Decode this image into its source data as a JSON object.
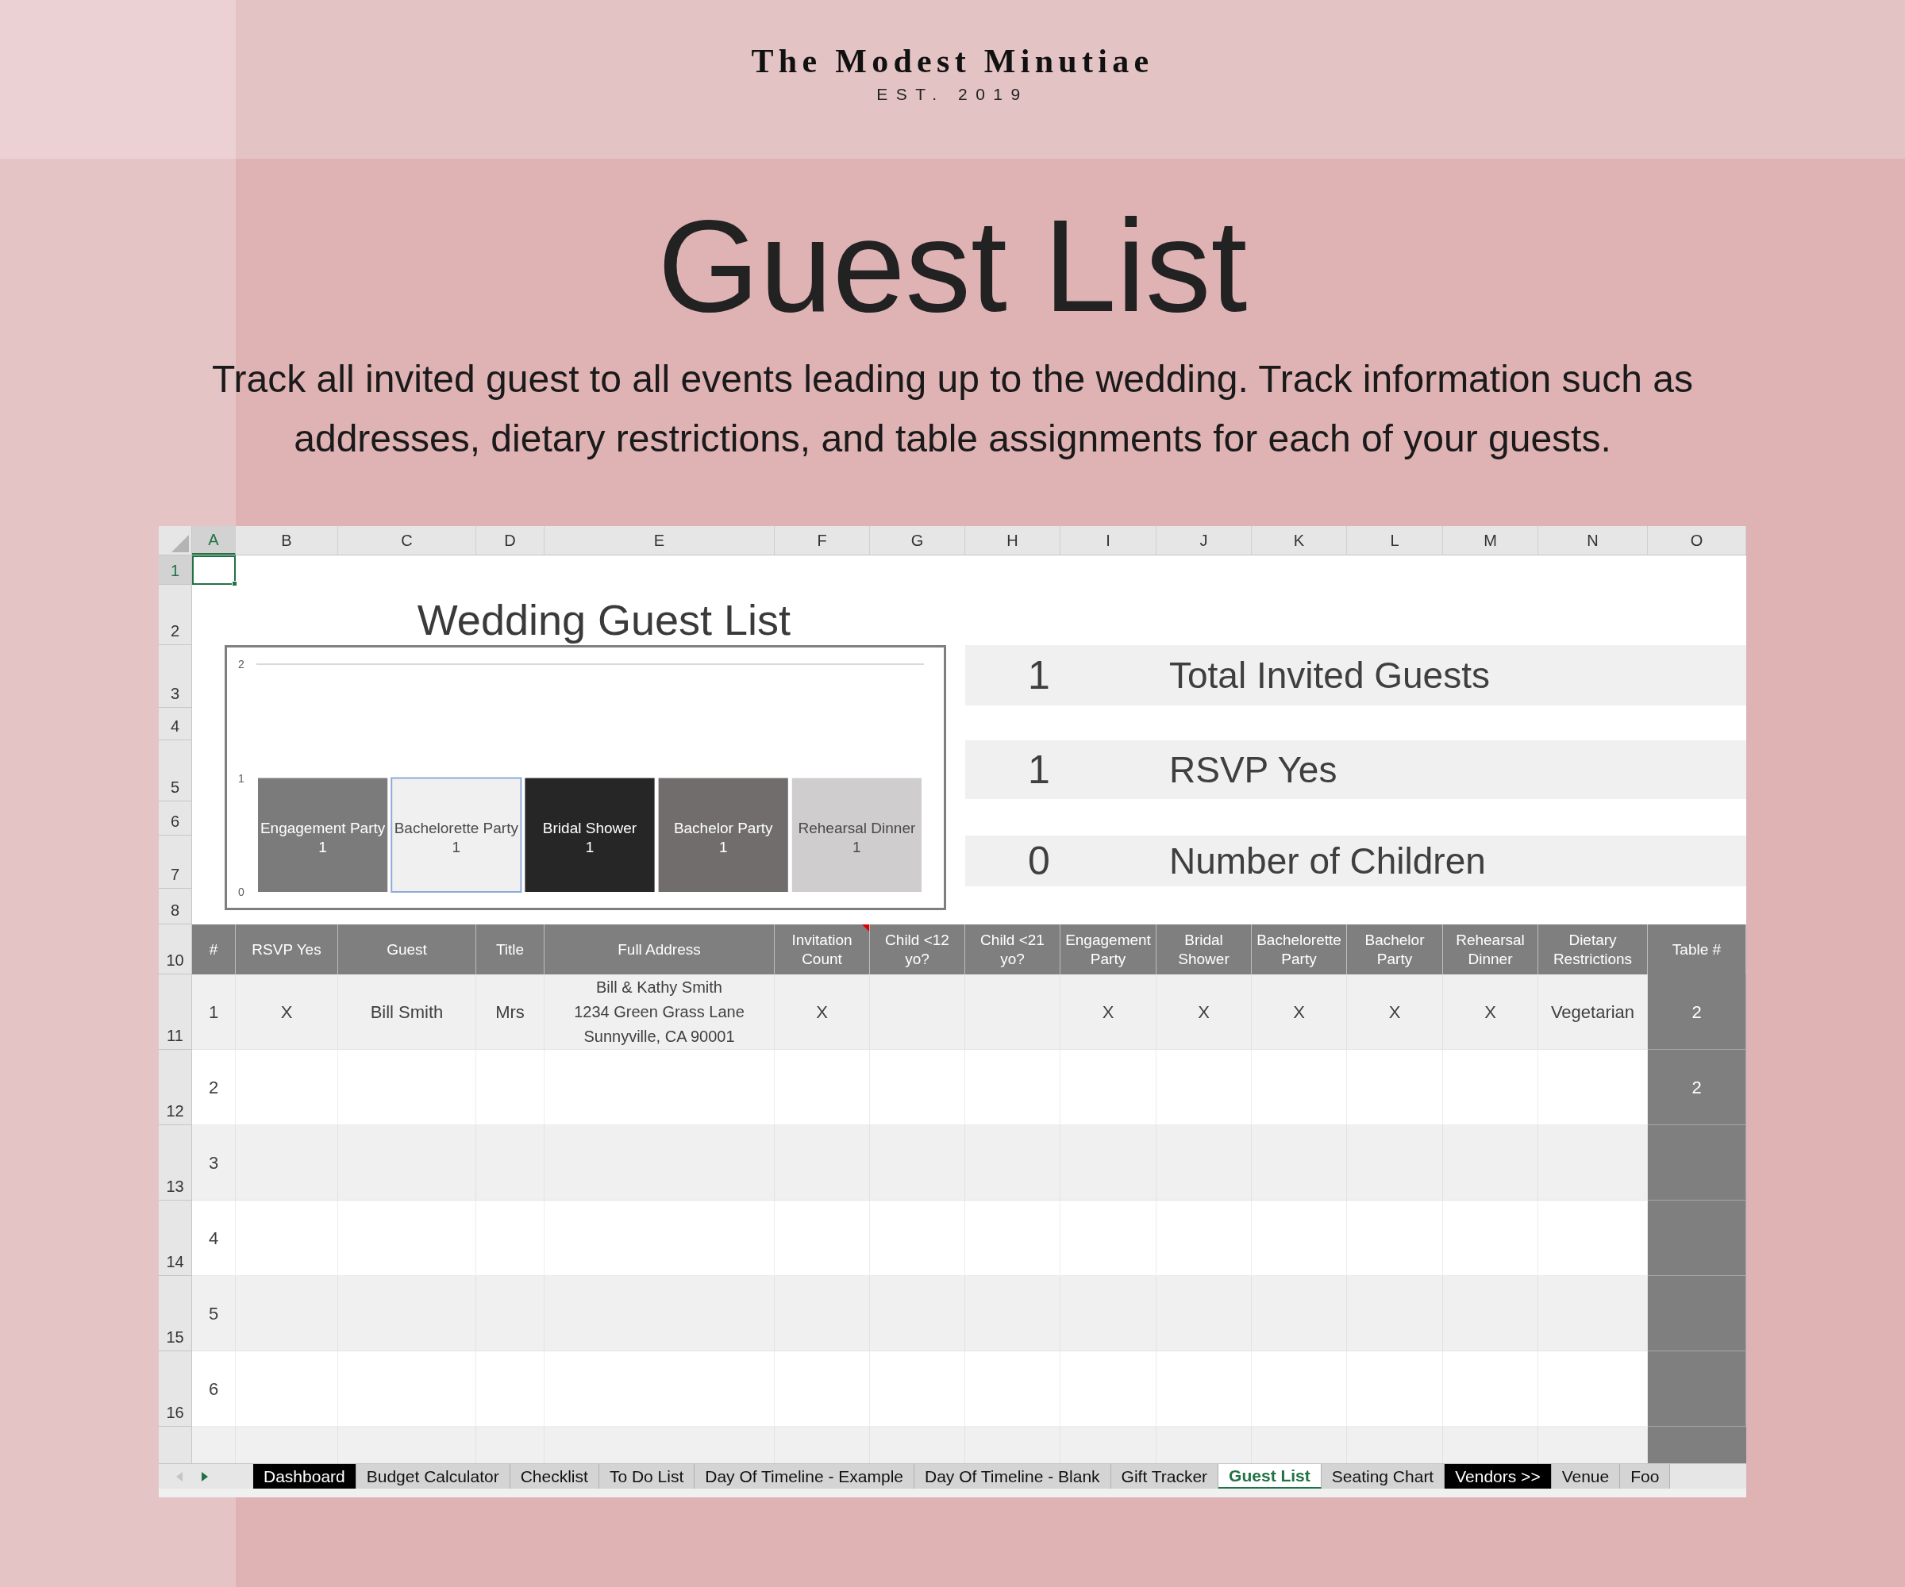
{
  "brand": {
    "name": "The Modest Minutiae",
    "established": "EST. 2019"
  },
  "heading": "Guest List",
  "description": "Track all invited guest to all events leading up to the wedding. Track information such as addresses, dietary restrictions, and table assignments for each of your guests.",
  "sheet": {
    "column_headers": [
      {
        "label": "A",
        "selected": true
      },
      {
        "label": "B",
        "selected": false
      },
      {
        "label": "C",
        "selected": false
      },
      {
        "label": "D",
        "selected": false
      },
      {
        "label": "E",
        "selected": false
      },
      {
        "label": "F",
        "selected": false
      },
      {
        "label": "G",
        "selected": false
      },
      {
        "label": "H",
        "selected": false
      },
      {
        "label": "I",
        "selected": false
      },
      {
        "label": "J",
        "selected": false
      },
      {
        "label": "K",
        "selected": false
      },
      {
        "label": "L",
        "selected": false
      },
      {
        "label": "M",
        "selected": false
      },
      {
        "label": "N",
        "selected": false
      },
      {
        "label": "O",
        "selected": false
      }
    ],
    "top_row_headers": [
      {
        "label": "1",
        "selected": true
      },
      {
        "label": "2",
        "selected": false
      },
      {
        "label": "3",
        "selected": false
      },
      {
        "label": "4",
        "selected": false
      },
      {
        "label": "5",
        "selected": false
      },
      {
        "label": "6",
        "selected": false
      },
      {
        "label": "7",
        "selected": false
      },
      {
        "label": "8",
        "selected": false
      }
    ],
    "title": "Wedding Guest List",
    "chart_data": {
      "type": "bar",
      "categories": [
        "Engagement Party",
        "Bachelorette Party",
        "Bridal Shower",
        "Bachelor Party",
        "Rehearsal Dinner"
      ],
      "series": [
        {
          "values": [
            1,
            1,
            1,
            1,
            1
          ]
        }
      ],
      "colors": [
        "#7b7b7b",
        "#f0f0f0",
        "#262626",
        "#716d6d",
        "#cfcdcd"
      ],
      "ylim": [
        0,
        2
      ],
      "yticks": [
        0,
        1,
        2
      ],
      "value_labels": [
        "1",
        "1",
        "1",
        "1",
        "1"
      ]
    },
    "summary": [
      {
        "value": "1",
        "label": "Total Invited Guests"
      },
      {
        "value": "1",
        "label": "RSVP Yes"
      },
      {
        "value": "0",
        "label": "Number of Children"
      }
    ],
    "table": {
      "row_header": "10",
      "columns": [
        {
          "label": "#"
        },
        {
          "label": "RSVP Yes"
        },
        {
          "label": "Guest"
        },
        {
          "label": "Title"
        },
        {
          "label": "Full Address"
        },
        {
          "label": "Invitation Count",
          "comment": true
        },
        {
          "label": "Child <12 yo?"
        },
        {
          "label": "Child <21 yo?"
        },
        {
          "label": "Engagement Party"
        },
        {
          "label": "Bridal Shower"
        },
        {
          "label": "Bachelorette Party"
        },
        {
          "label": "Bachelor Party"
        },
        {
          "label": "Rehearsal Dinner"
        },
        {
          "label": "Dietary Restrictions"
        },
        {
          "label": "Table #"
        }
      ],
      "rows": [
        {
          "row_header": "11",
          "cells": [
            "1",
            "X",
            "Bill Smith",
            "Mrs",
            [
              "Bill & Kathy Smith",
              "1234 Green Grass Lane",
              "Sunnyville, CA 90001"
            ],
            "X",
            null,
            null,
            "X",
            "X",
            "X",
            "X",
            "X",
            "Vegetarian",
            "2"
          ]
        },
        {
          "row_header": "12",
          "cells": [
            "2",
            null,
            null,
            null,
            null,
            null,
            null,
            null,
            null,
            null,
            null,
            null,
            null,
            null,
            "2"
          ]
        },
        {
          "row_header": "13",
          "cells": [
            "3",
            null,
            null,
            null,
            null,
            null,
            null,
            null,
            null,
            null,
            null,
            null,
            null,
            null,
            null
          ]
        },
        {
          "row_header": "14",
          "cells": [
            "4",
            null,
            null,
            null,
            null,
            null,
            null,
            null,
            null,
            null,
            null,
            null,
            null,
            null,
            null
          ]
        },
        {
          "row_header": "15",
          "cells": [
            "5",
            null,
            null,
            null,
            null,
            null,
            null,
            null,
            null,
            null,
            null,
            null,
            null,
            null,
            null
          ]
        },
        {
          "row_header": "16",
          "cells": [
            "6",
            null,
            null,
            null,
            null,
            null,
            null,
            null,
            null,
            null,
            null,
            null,
            null,
            null,
            null
          ]
        }
      ]
    }
  },
  "sheet_tabs": [
    {
      "label": "Dashboard",
      "selected": false,
      "color": "#000000"
    },
    {
      "label": "Budget Calculator",
      "selected": false
    },
    {
      "label": "Checklist",
      "selected": false
    },
    {
      "label": "To Do List",
      "selected": false
    },
    {
      "label": "Day Of Timeline - Example",
      "selected": false
    },
    {
      "label": "Day Of Timeline - Blank",
      "selected": false
    },
    {
      "label": "Gift Tracker",
      "selected": false
    },
    {
      "label": "Guest List",
      "selected": true
    },
    {
      "label": "Seating Chart",
      "selected": false
    },
    {
      "label": "Vendors >>",
      "selected": false,
      "color": "#000000"
    },
    {
      "label": "Venue",
      "selected": false
    },
    {
      "label": "Foo",
      "selected": false
    }
  ]
}
